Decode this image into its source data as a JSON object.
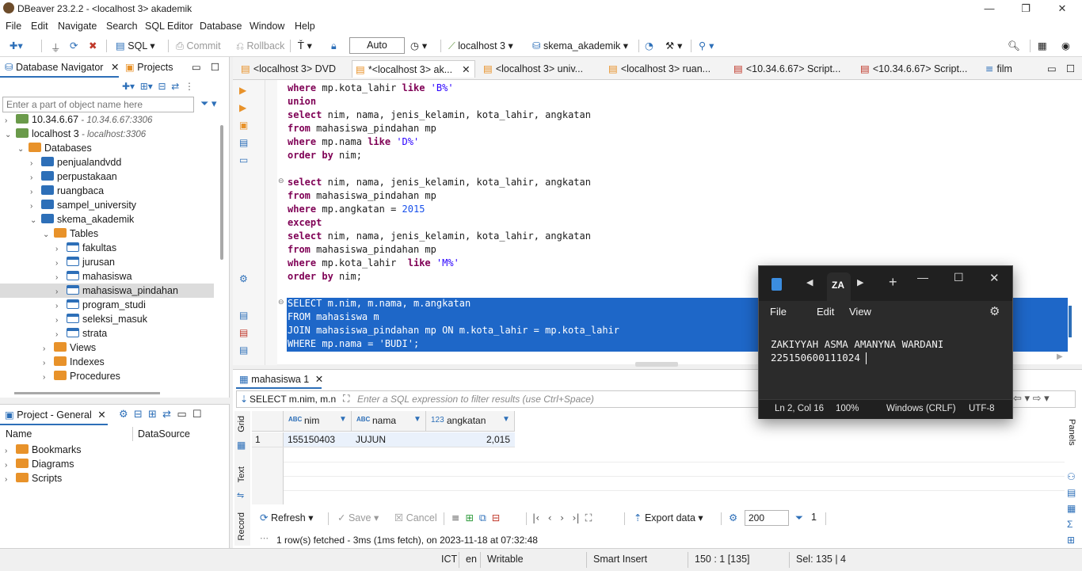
{
  "window": {
    "title": "DBeaver 23.2.2 - <localhost 3> akademik",
    "minimize": "—",
    "restore": "❐",
    "close": "✕"
  },
  "menu": [
    "File",
    "Edit",
    "Navigate",
    "Search",
    "SQL Editor",
    "Database",
    "Window",
    "Help"
  ],
  "toolbar": {
    "sql_label": "SQL",
    "commit_label": "Commit",
    "rollback_label": "Rollback",
    "auto_label": "Auto",
    "connection": "localhost 3",
    "schema": "skema_akademik"
  },
  "navigator": {
    "tab_database": "Database Navigator",
    "tab_projects": "Projects",
    "filter_placeholder": "Enter a part of object name here",
    "tree": [
      {
        "label": "10.34.6.67",
        "sub": " - 10.34.6.67:3306",
        "icon": "server-icon",
        "level": 0,
        "arrow": "›"
      },
      {
        "label": "localhost 3",
        "sub": " - localhost:3306",
        "icon": "server-icon",
        "level": 0,
        "arrow": "⌄"
      },
      {
        "label": "Databases",
        "sub": "",
        "icon": "folder-icon",
        "level": 1,
        "arrow": "⌄"
      },
      {
        "label": "penjualandvdd",
        "sub": "",
        "icon": "database-icon",
        "level": 2,
        "arrow": "›"
      },
      {
        "label": "perpustakaan",
        "sub": "",
        "icon": "database-icon",
        "level": 2,
        "arrow": "›"
      },
      {
        "label": "ruangbaca",
        "sub": "",
        "icon": "database-icon",
        "level": 2,
        "arrow": "›"
      },
      {
        "label": "sampel_university",
        "sub": "",
        "icon": "database-icon",
        "level": 2,
        "arrow": "›"
      },
      {
        "label": "skema_akademik",
        "sub": "",
        "icon": "database-icon",
        "level": 2,
        "arrow": "⌄"
      },
      {
        "label": "Tables",
        "sub": "",
        "icon": "folder-icon",
        "level": 3,
        "arrow": "⌄"
      },
      {
        "label": "fakultas",
        "sub": "",
        "icon": "table-icon",
        "level": 4,
        "arrow": "›"
      },
      {
        "label": "jurusan",
        "sub": "",
        "icon": "table-icon",
        "level": 4,
        "arrow": "›"
      },
      {
        "label": "mahasiswa",
        "sub": "",
        "icon": "table-icon",
        "level": 4,
        "arrow": "›"
      },
      {
        "label": "mahasiswa_pindahan",
        "sub": "",
        "icon": "table-icon",
        "level": 4,
        "arrow": "›"
      },
      {
        "label": "program_studi",
        "sub": "",
        "icon": "table-icon",
        "level": 4,
        "arrow": "›"
      },
      {
        "label": "seleksi_masuk",
        "sub": "",
        "icon": "table-icon",
        "level": 4,
        "arrow": "›"
      },
      {
        "label": "strata",
        "sub": "",
        "icon": "table-icon",
        "level": 4,
        "arrow": "›"
      },
      {
        "label": "Views",
        "sub": "",
        "icon": "folder-icon",
        "level": 3,
        "arrow": "›"
      },
      {
        "label": "Indexes",
        "sub": "",
        "icon": "folder-icon",
        "level": 3,
        "arrow": "›"
      },
      {
        "label": "Procedures",
        "sub": "",
        "icon": "folder-icon",
        "level": 3,
        "arrow": "›"
      }
    ]
  },
  "project": {
    "tab": "Project - General",
    "col_name": "Name",
    "col_datasource": "DataSource",
    "items": [
      "Bookmarks",
      "Diagrams",
      "Scripts"
    ]
  },
  "editor_tabs": [
    "<localhost 3> DVD",
    "*<localhost 3> ak...",
    "<localhost 3> univ...",
    "<localhost 3> ruan...",
    "<10.34.6.67> Script...",
    "<10.34.6.67> Script...",
    "film"
  ],
  "code": {
    "lines": [
      "where mp.kota_lahir like 'B%'",
      "union",
      "select nim, nama, jenis_kelamin, kota_lahir, angkatan",
      "from mahasiswa_pindahan mp",
      "where mp.nama like 'D%'",
      "order by nim;",
      "",
      "select nim, nama, jenis_kelamin, kota_lahir, angkatan",
      "from mahasiswa_pindahan mp",
      "where mp.angkatan = 2015",
      "except",
      "select nim, nama, jenis_kelamin, kota_lahir, angkatan",
      "from mahasiswa_pindahan mp",
      "where mp.kota_lahir  like 'M%'",
      "order by nim;",
      "",
      "SELECT m.nim, m.nama, m.angkatan",
      "FROM mahasiswa m",
      "JOIN mahasiswa_pindahan mp ON m.kota_lahir = mp.kota_lahir",
      "WHERE mp.nama = 'BUDI';"
    ]
  },
  "results": {
    "tab": "mahasiswa 1",
    "query_preview": "SELECT m.nim, m.n",
    "filter_placeholder": "Enter a SQL expression to filter results (use Ctrl+Space)",
    "columns": [
      {
        "type": "ABC",
        "name": "nim"
      },
      {
        "type": "ABC",
        "name": "nama"
      },
      {
        "type": "123",
        "name": "angkatan"
      }
    ],
    "rows": [
      {
        "index": "1",
        "nim": "155150403",
        "nama": "JUJUN",
        "angkatan": "2,015"
      }
    ],
    "side_tabs": [
      "Grid",
      "Text",
      "Record"
    ],
    "panels_label": "Panels",
    "refresh": "Refresh",
    "save": "Save",
    "cancel": "Cancel",
    "export": "Export data",
    "limit": "200",
    "count": "1",
    "fetched": "1 row(s) fetched - 3ms (1ms fetch), on 2023-11-18 at 07:32:48"
  },
  "status": {
    "tz": "ICT",
    "lang": "en",
    "mode": "Writable",
    "insert": "Smart Insert",
    "position": "150 : 1 [135]",
    "selection": "Sel: 135 | 4"
  },
  "notepad": {
    "tab_label": "ZA",
    "menu": [
      "File",
      "Edit",
      "View"
    ],
    "lines": [
      "ZAKIYYAH ASMA AMANYNA WARDANI",
      "225150600111024"
    ],
    "position": "Ln 2, Col 16",
    "zoom": "100%",
    "eol": "Windows (CRLF)",
    "encoding": "UTF-8"
  }
}
